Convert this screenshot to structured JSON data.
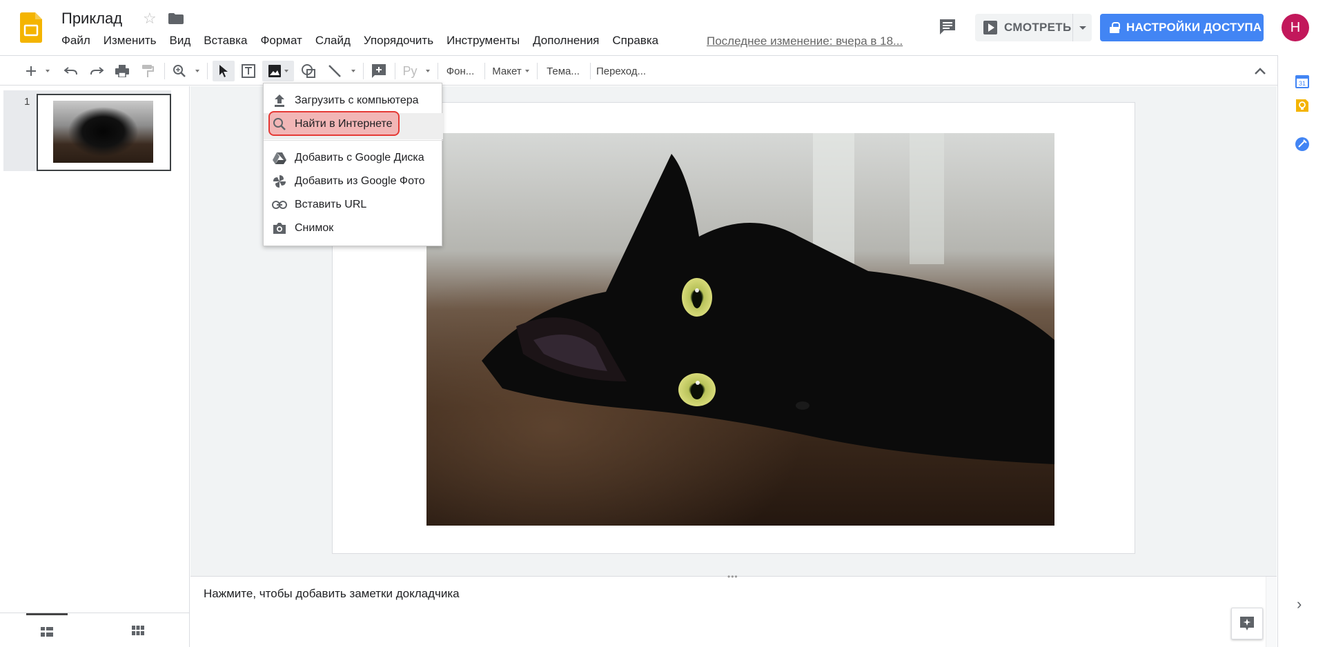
{
  "header": {
    "doc_title": "Приклад",
    "menu": [
      "Файл",
      "Изменить",
      "Вид",
      "Вставка",
      "Формат",
      "Слайд",
      "Упорядочить",
      "Инструменты",
      "Дополнения",
      "Справка"
    ],
    "last_edit": "Последнее изменение: вчера в 18...",
    "present_label": "СМОТРЕТЬ",
    "share_label": "НАСТРОЙКИ ДОСТУПА",
    "avatar_letter": "Н"
  },
  "toolbar": {
    "input_tools_label": "Ру",
    "background_label": "Фон...",
    "layout_label": "Макет",
    "theme_label": "Тема...",
    "transition_label": "Переход..."
  },
  "filmstrip": {
    "slide_number": "1"
  },
  "image_menu": {
    "items": [
      {
        "label": "Загрузить с компьютера",
        "icon": "upload-icon"
      },
      {
        "label": "Найти в Интернете",
        "icon": "search-icon"
      },
      {
        "label": "Добавить с Google Диска",
        "icon": "drive-icon"
      },
      {
        "label": "Добавить из Google Фото",
        "icon": "photos-icon"
      },
      {
        "label": "Вставить URL",
        "icon": "link-icon"
      },
      {
        "label": "Снимок",
        "icon": "camera-icon"
      }
    ],
    "highlighted_index": 1
  },
  "slide": {
    "image_description_icon": "cat-photo"
  },
  "notes": {
    "placeholder": "Нажмите, чтобы добавить заметки докладчика"
  },
  "side_panel": {
    "calendar_day": "31"
  },
  "colors": {
    "brand_yellow": "#f4b400",
    "share_blue": "#4285f4",
    "avatar_pink": "#c2185b",
    "highlight_red": "#e53935"
  }
}
